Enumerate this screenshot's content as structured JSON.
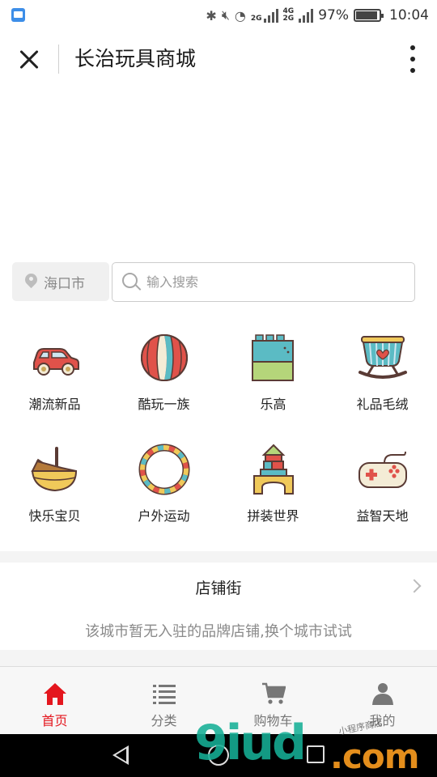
{
  "status_bar": {
    "battery": "97%",
    "time": "10:04",
    "net_top": "4G",
    "net_bottom": "2G",
    "sim_tag": "2G"
  },
  "header": {
    "title": "长治玩具商城"
  },
  "location": {
    "city": "海口市"
  },
  "search": {
    "placeholder": "输入搜索"
  },
  "categories": [
    {
      "label": "潮流新品",
      "icon": "car-icon"
    },
    {
      "label": "酷玩一族",
      "icon": "ball-icon"
    },
    {
      "label": "乐高",
      "icon": "lego-brick-icon"
    },
    {
      "label": "礼品毛绒",
      "icon": "cradle-icon"
    },
    {
      "label": "快乐宝贝",
      "icon": "bassinet-icon"
    },
    {
      "label": "户外运动",
      "icon": "hoop-icon"
    },
    {
      "label": "拼装世界",
      "icon": "building-blocks-icon"
    },
    {
      "label": "益智天地",
      "icon": "gamepad-icon"
    }
  ],
  "shop_street": {
    "title": "店铺街",
    "empty_message": "该城市暂无入驻的品牌店铺,换个城市试试"
  },
  "tabbar": {
    "items": [
      {
        "label": "首页",
        "icon": "home-icon",
        "active": true
      },
      {
        "label": "分类",
        "icon": "list-icon",
        "active": false
      },
      {
        "label": "购物车",
        "icon": "cart-icon",
        "active": false
      },
      {
        "label": "我的",
        "icon": "user-icon",
        "active": false
      }
    ]
  },
  "watermark": {
    "main": "9iud",
    "suffix": ".com",
    "caption": "小程序商店"
  },
  "colors": {
    "accent": "#e4161e",
    "inactive": "#777777"
  }
}
